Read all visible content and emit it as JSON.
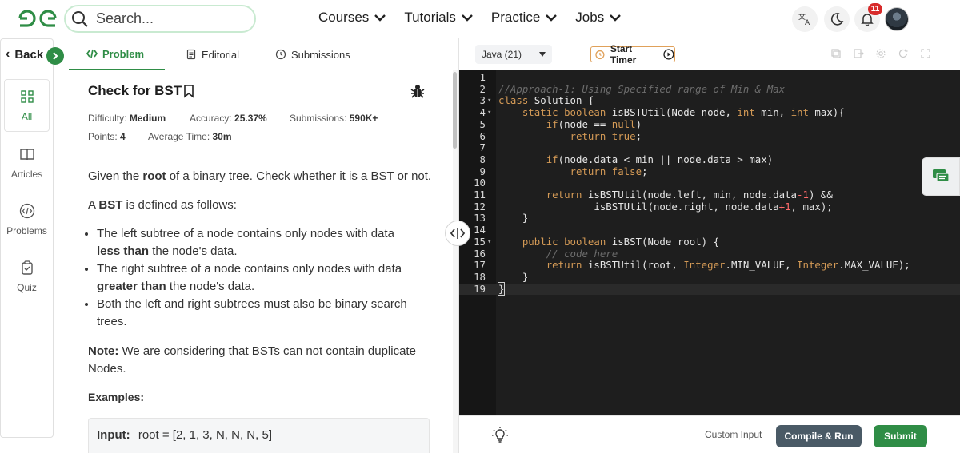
{
  "brand": {
    "accent": "#2f8d46"
  },
  "search": {
    "placeholder": "Search..."
  },
  "nav": {
    "items": [
      {
        "label": "Courses"
      },
      {
        "label": "Tutorials"
      },
      {
        "label": "Practice"
      },
      {
        "label": "Jobs"
      }
    ],
    "notifications_count": "11"
  },
  "sidebar": {
    "back_label": "Back",
    "items": [
      {
        "label": "All",
        "icon": "grid-icon",
        "active": true
      },
      {
        "label": "Articles",
        "icon": "book-icon"
      },
      {
        "label": "Problems",
        "icon": "code-circle-icon"
      },
      {
        "label": "Quiz",
        "icon": "clipboard-icon"
      }
    ]
  },
  "problem_tabs": [
    {
      "label": "Problem",
      "icon": "code-icon",
      "active": true
    },
    {
      "label": "Editorial",
      "icon": "document-icon"
    },
    {
      "label": "Submissions",
      "icon": "clock-icon"
    }
  ],
  "problem": {
    "title": "Check for BST",
    "difficulty_label": "Difficulty:",
    "difficulty": "Medium",
    "accuracy_label": "Accuracy:",
    "accuracy": "25.37%",
    "submissions_label": "Submissions:",
    "submissions": "590K+",
    "points_label": "Points:",
    "points": "4",
    "avg_time_label": "Average Time:",
    "avg_time": "30m",
    "intro_pre": "Given the ",
    "intro_bold": "root",
    "intro_post": " of a binary tree. Check whether it is a BST or not.",
    "bst_pre": "A ",
    "bst_bold": "BST",
    "bst_post": " is defined as follows:",
    "bullets": [
      {
        "pre": "The left subtree of a node contains only nodes with data ",
        "bold": "less than",
        "post": " the node's data."
      },
      {
        "pre": "The right subtree of a node contains only nodes with data ",
        "bold": "greater than",
        "post": " the node's data."
      },
      {
        "pre": "Both the left and right subtrees must also be binary search trees.",
        "bold": "",
        "post": ""
      }
    ],
    "note_label": "Note:",
    "note_text": " We are considering that BSTs can not contain duplicate Nodes.",
    "examples_label": "Examples:",
    "example_input_label": "Input:",
    "example_input": "root  =  [2,  1,  3,  N,  N,  N,  5]"
  },
  "editor": {
    "language": "Java (21)",
    "timer_label": "Start Timer",
    "lines": [
      {
        "n": "1",
        "fold": "",
        "html": ""
      },
      {
        "n": "2",
        "fold": "",
        "html": "<span class=\"cmt\">//Approach-1: Using Specified range of Min &amp; Max</span>"
      },
      {
        "n": "3",
        "fold": "▾",
        "html": "<span class=\"kw\">class</span> Solution {"
      },
      {
        "n": "4",
        "fold": "▾",
        "html": "    <span class=\"kw\">static</span> <span class=\"kw\">boolean</span> isBSTUtil(Node node, <span class=\"kw\">int</span> min, <span class=\"kw\">int</span> max){"
      },
      {
        "n": "5",
        "fold": "",
        "html": "        <span class=\"kw\">if</span>(node == <span class=\"kw\">null</span>)"
      },
      {
        "n": "6",
        "fold": "",
        "html": "            <span class=\"kw\">return</span> <span class=\"kw\">true</span>;"
      },
      {
        "n": "7",
        "fold": "",
        "html": ""
      },
      {
        "n": "8",
        "fold": "",
        "html": "        <span class=\"kw\">if</span>(node.data &lt; min || node.data &gt; max)"
      },
      {
        "n": "9",
        "fold": "",
        "html": "            <span class=\"kw\">return</span> <span class=\"kw\">false</span>;"
      },
      {
        "n": "10",
        "fold": "",
        "html": ""
      },
      {
        "n": "11",
        "fold": "",
        "html": "        <span class=\"kw\">return</span> isBSTUtil(node.left, min, node.data<span class=\"num\">-1</span>) &amp;&amp;"
      },
      {
        "n": "12",
        "fold": "",
        "html": "                isBSTUtil(node.right, node.data<span class=\"num\">+1</span>, max);"
      },
      {
        "n": "13",
        "fold": "",
        "html": "    }"
      },
      {
        "n": "14",
        "fold": "",
        "html": ""
      },
      {
        "n": "15",
        "fold": "▾",
        "html": "    <span class=\"kw\">public</span> <span class=\"kw\">boolean</span> isBST(Node root) {"
      },
      {
        "n": "16",
        "fold": "",
        "html": "        <span class=\"cmt\">// code here</span>"
      },
      {
        "n": "17",
        "fold": "",
        "html": "        <span class=\"kw\">return</span> isBSTUtil(root, <span class=\"kw\">Integer</span>.MIN_VALUE, <span class=\"kw\">Integer</span>.MAX_VALUE);"
      },
      {
        "n": "18",
        "fold": "",
        "html": "    }"
      },
      {
        "n": "19",
        "fold": "",
        "html": "<span class=\"cursor-bracket\">}</span>"
      }
    ],
    "custom_input_label": "Custom Input",
    "compile_label": "Compile & Run",
    "submit_label": "Submit"
  }
}
